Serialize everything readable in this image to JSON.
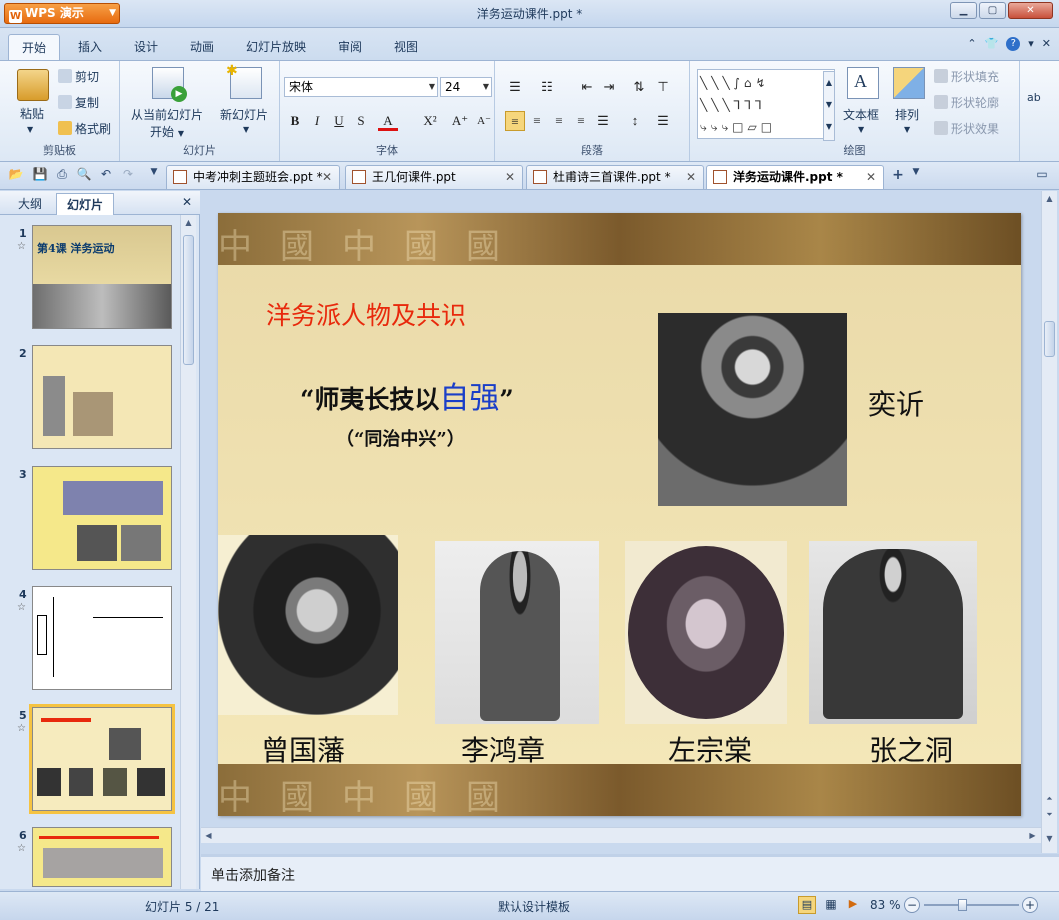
{
  "app": {
    "logo": "WPS 演示",
    "window_title": "洋务运动课件.ppt *"
  },
  "ribbon_tabs": [
    "开始",
    "插入",
    "设计",
    "动画",
    "幻灯片放映",
    "审阅",
    "视图"
  ],
  "ribbon": {
    "clipboard": {
      "paste": "粘贴",
      "cut": "剪切",
      "copy": "复制",
      "format_painter": "格式刷",
      "label": "剪贴板"
    },
    "slides": {
      "from_current": "从当前幻灯片",
      "start": "开始",
      "new_slide": "新幻灯片",
      "label": "幻灯片"
    },
    "font": {
      "name": "宋体",
      "size": "24",
      "label": "字体"
    },
    "paragraph": {
      "label": "段落"
    },
    "drawing": {
      "textbox": "文本框",
      "arrange": "排列",
      "shape_fill": "形状填充",
      "shape_outline": "形状轮廓",
      "shape_effect": "形状效果",
      "label": "绘图"
    }
  },
  "doc_tabs": [
    {
      "title": "中考冲刺主题班会.ppt *"
    },
    {
      "title": "王几何课件.ppt"
    },
    {
      "title": "杜甫诗三首课件.ppt *"
    },
    {
      "title": "洋务运动课件.ppt *"
    }
  ],
  "left_panel": {
    "tabs": [
      "大纲",
      "幻灯片"
    ],
    "thumbnails": [
      {
        "num": "1",
        "text": "第4课 洋务运动"
      },
      {
        "num": "2",
        "text": ""
      },
      {
        "num": "3",
        "text": ""
      },
      {
        "num": "4",
        "text": ""
      },
      {
        "num": "5",
        "text": ""
      },
      {
        "num": "6",
        "text": ""
      }
    ]
  },
  "slide": {
    "title": "洋务派人物及共识",
    "motto_open": "“师夷长技以",
    "motto_highlight": "自强",
    "motto_close": "”",
    "subtitle": "（“同治中兴”）",
    "people": [
      "奕䜣",
      "曾国藩",
      "李鸿章",
      "左宗棠",
      "张之洞"
    ]
  },
  "notes_placeholder": "单击添加备注",
  "status": {
    "slide_position": "幻灯片 5 / 21",
    "template": "默认设计模板",
    "zoom": "83 %"
  }
}
